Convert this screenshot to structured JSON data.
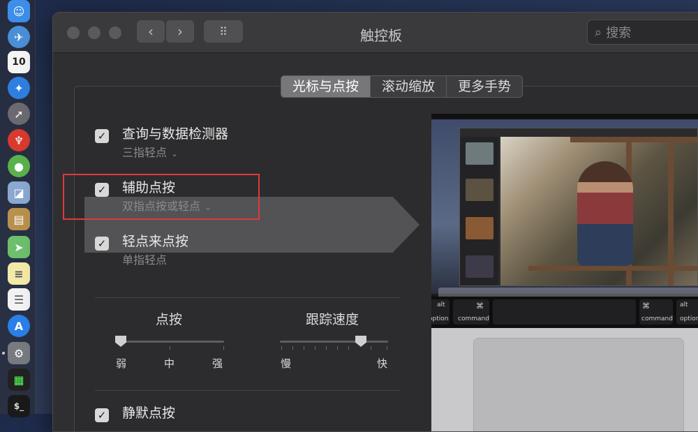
{
  "window": {
    "title": "触控板",
    "search_placeholder": "搜索"
  },
  "tabs": [
    {
      "label": "光标与点按",
      "active": true
    },
    {
      "label": "滚动缩放",
      "active": false
    },
    {
      "label": "更多手势",
      "active": false
    }
  ],
  "options": [
    {
      "title": "查询与数据检测器",
      "subtitle": "三指轻点",
      "checked": true,
      "has_menu": true
    },
    {
      "title": "辅助点按",
      "subtitle": "双指点按或轻点",
      "checked": true,
      "has_menu": true
    },
    {
      "title": "轻点来点按",
      "subtitle": "单指轻点",
      "checked": true,
      "has_menu": false
    },
    {
      "title": "静默点按",
      "subtitle": "",
      "checked": true,
      "has_menu": false
    }
  ],
  "click_slider": {
    "label": "点按",
    "ticks": [
      "弱",
      "中",
      "强"
    ],
    "value": 0
  },
  "speed_slider": {
    "label": "跟踪速度",
    "min_label": "慢",
    "max_label": "快",
    "value": 0.75
  },
  "preview_keys": {
    "alt_left": "alt",
    "option_left": "option",
    "cmd_symbol": "⌘",
    "command_label": "command",
    "alt_right": "alt",
    "option_right": "option"
  },
  "colors": {
    "highlight": "#e03a3a",
    "window_bg": "#2f2f31",
    "tab_active": "#777779"
  }
}
